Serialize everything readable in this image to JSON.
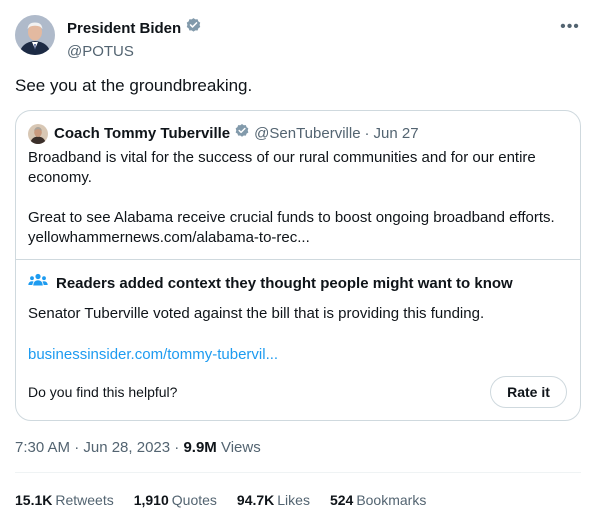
{
  "author": {
    "display_name": "President Biden",
    "handle": "@POTUS",
    "verified_color": "#829aab"
  },
  "more_icon": "•••",
  "tweet": {
    "text": "See you at the groundbreaking."
  },
  "quote": {
    "display_name": "Coach Tommy Tuberville",
    "handle": "@SenTuberville",
    "separator": "·",
    "date": "Jun 27",
    "paragraph1": "Broadband is vital for the success of our rural communities and for our entire economy.",
    "paragraph2": "Great to see Alabama receive crucial funds to boost ongoing broadband efforts. yellowhammernews.com/alabama-to-rec..."
  },
  "community_note": {
    "title": "Readers added context they thought people might want to know",
    "text": "Senator Tuberville voted against the bill that is providing this funding.",
    "link": "businessinsider.com/tommy-tubervil...",
    "question": "Do you find this helpful?",
    "rate_label": "Rate it",
    "icon_color": "#1d9bf0"
  },
  "meta": {
    "time_date": "7:30 AM · Jun 28, 2023 · ",
    "views_count": "9.9M",
    "views_label": " Views"
  },
  "stats": [
    {
      "count": "15.1K",
      "label": "Retweets"
    },
    {
      "count": "1,910",
      "label": "Quotes"
    },
    {
      "count": "94.7K",
      "label": "Likes"
    },
    {
      "count": "524",
      "label": "Bookmarks"
    }
  ]
}
